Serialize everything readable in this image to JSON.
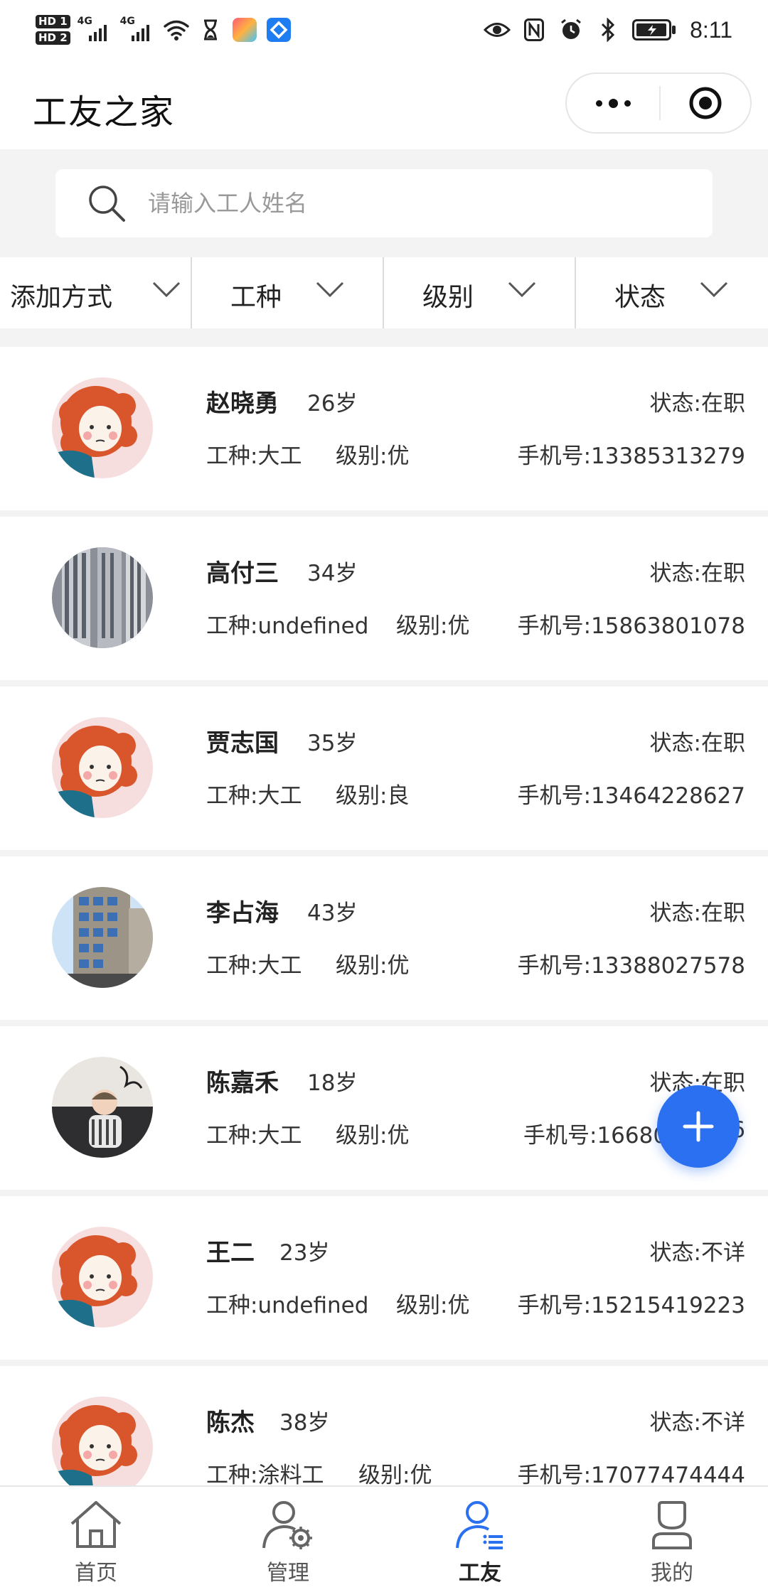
{
  "status_bar": {
    "time": "8:11",
    "sim1_badge": "HD 1",
    "sim2_badge": "HD 2",
    "network1": "4G",
    "network2": "4G",
    "icons_left": [
      "signal-icon",
      "signal-icon",
      "wifi-icon",
      "hourglass-icon",
      "app-icon",
      "app-icon"
    ],
    "icons_right": [
      "eye-icon",
      "nfc-icon",
      "alarm-icon",
      "bluetooth-icon",
      "battery-icon"
    ]
  },
  "header": {
    "title": "工友之家",
    "more_icon": "more-dots-icon",
    "close_icon": "target-icon"
  },
  "search": {
    "placeholder": "请输入工人姓名",
    "icon": "search-icon"
  },
  "filters": [
    {
      "label": "添加方式"
    },
    {
      "label": "工种"
    },
    {
      "label": "级别"
    },
    {
      "label": "状态"
    }
  ],
  "workers": [
    {
      "name": "赵晓勇",
      "age": "26岁",
      "status": "状态:在职",
      "type": "工种:大工",
      "level": "级别:优",
      "phone": "手机号:13385313279",
      "avatar": "cartoon-girl"
    },
    {
      "name": "高付三",
      "age": "34岁",
      "status": "状态:在职",
      "type": "工种:undefined",
      "level": "级别:优",
      "phone": "手机号:15863801078",
      "avatar": "building"
    },
    {
      "name": "贾志国",
      "age": "35岁",
      "status": "状态:在职",
      "type": "工种:大工",
      "level": "级别:良",
      "phone": "手机号:13464228627",
      "avatar": "cartoon-girl"
    },
    {
      "name": "李占海",
      "age": "43岁",
      "status": "状态:在职",
      "type": "工种:大工",
      "level": "级别:优",
      "phone": "手机号:13388027578",
      "avatar": "building-blue"
    },
    {
      "name": "陈嘉禾",
      "age": "18岁",
      "status": "状态:在职",
      "type": "工种:大工",
      "level": "级别:优",
      "phone": "手机号:16680",
      "phone_tail": "6",
      "avatar": "baby-photo"
    },
    {
      "name": "王二",
      "age": "23岁",
      "status": "状态:不详",
      "type": "工种:undefined",
      "level": "级别:优",
      "phone": "手机号:15215419223",
      "avatar": "cartoon-girl"
    },
    {
      "name": "陈杰",
      "age": "38岁",
      "status": "状态:不详",
      "type": "工种:涂料工",
      "level": "级别:优",
      "phone": "手机号:17077474444",
      "avatar": "cartoon-girl"
    }
  ],
  "fab": {
    "icon": "plus-icon"
  },
  "tabs": [
    {
      "label": "首页",
      "icon": "home-icon"
    },
    {
      "label": "管理",
      "icon": "user-gear-icon"
    },
    {
      "label": "工友",
      "icon": "user-list-icon",
      "active": true
    },
    {
      "label": "我的",
      "icon": "profile-icon"
    }
  ],
  "colors": {
    "accent": "#2b70f0",
    "background": "#f3f3f4",
    "text": "#222222"
  }
}
